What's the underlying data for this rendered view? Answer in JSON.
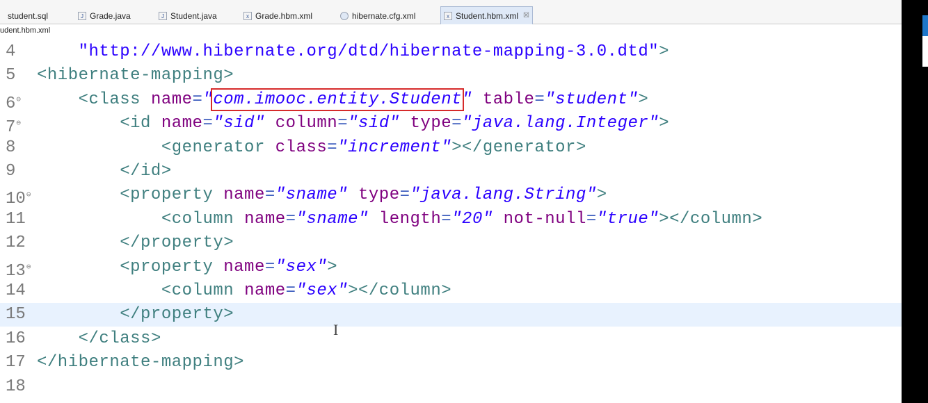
{
  "tabs": [
    {
      "label": "student.sql",
      "icon": "sql-file-icon"
    },
    {
      "label": "Grade.java",
      "icon": "java-file-icon"
    },
    {
      "label": "Student.java",
      "icon": "java-file-icon"
    },
    {
      "label": "Grade.hbm.xml",
      "icon": "xml-file-icon"
    },
    {
      "label": "hibernate.cfg.xml",
      "icon": "config-file-icon"
    },
    {
      "label": "Student.hbm.xml",
      "icon": "xml-file-icon",
      "active": true,
      "close": "☒"
    }
  ],
  "breadcrumb": "udent.hbm.xml",
  "editor": {
    "current_line": 15,
    "highlight_box_text": "com.imooc.entity.Student",
    "lines": [
      {
        "num": "4",
        "fold": "",
        "text": "    \"http://www.hibernate.org/dtd/hibernate-mapping-3.0.dtd\">"
      },
      {
        "num": "5",
        "fold": "",
        "text": "<hibernate-mapping>"
      },
      {
        "num": "6",
        "fold": "⊖",
        "text": "    <class name=\"com.imooc.entity.Student\" table=\"student\">"
      },
      {
        "num": "7",
        "fold": "⊖",
        "text": "        <id name=\"sid\" column=\"sid\" type=\"java.lang.Integer\">"
      },
      {
        "num": "8",
        "fold": "",
        "text": "            <generator class=\"increment\"></generator>"
      },
      {
        "num": "9",
        "fold": "",
        "text": "        </id>"
      },
      {
        "num": "10",
        "fold": "⊖",
        "text": "        <property name=\"sname\" type=\"java.lang.String\">"
      },
      {
        "num": "11",
        "fold": "",
        "text": "            <column name=\"sname\" length=\"20\" not-null=\"true\"></column>"
      },
      {
        "num": "12",
        "fold": "",
        "text": "        </property>"
      },
      {
        "num": "13",
        "fold": "⊖",
        "text": "        <property name=\"sex\">"
      },
      {
        "num": "14",
        "fold": "",
        "text": "            <column name=\"sex\"></column>"
      },
      {
        "num": "15",
        "fold": "",
        "text": "        </property>"
      },
      {
        "num": "16",
        "fold": "",
        "text": "    </class>"
      },
      {
        "num": "17",
        "fold": "",
        "text": "</hibernate-mapping>"
      },
      {
        "num": "18",
        "fold": "",
        "text": ""
      }
    ]
  }
}
